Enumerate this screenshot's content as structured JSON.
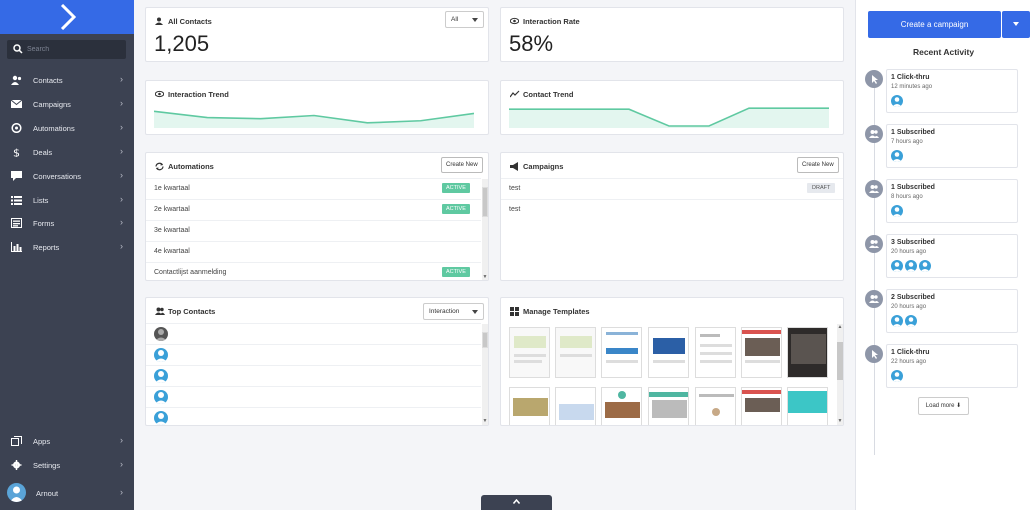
{
  "sidebar": {
    "search_placeholder": "Search",
    "items": [
      {
        "label": "Contacts",
        "icon": "contacts-icon"
      },
      {
        "label": "Campaigns",
        "icon": "envelope-icon"
      },
      {
        "label": "Automations",
        "icon": "automation-icon"
      },
      {
        "label": "Deals",
        "icon": "dollar-icon"
      },
      {
        "label": "Conversations",
        "icon": "chat-icon"
      },
      {
        "label": "Lists",
        "icon": "list-icon"
      },
      {
        "label": "Forms",
        "icon": "form-icon"
      },
      {
        "label": "Reports",
        "icon": "bar-chart-icon"
      }
    ],
    "bottom_items": [
      {
        "label": "Apps",
        "icon": "apps-icon"
      },
      {
        "label": "Settings",
        "icon": "gear-icon"
      }
    ],
    "user": {
      "label": "Arnout"
    },
    "chevron": "›"
  },
  "stats": {
    "contacts": {
      "title": "All Contacts",
      "value": "1,205",
      "filter": "All"
    },
    "interaction": {
      "title": "Interaction Rate",
      "value": "58%"
    }
  },
  "trends": {
    "interaction": {
      "title": "Interaction Trend",
      "points": [
        14,
        8,
        7,
        10,
        3,
        5,
        12
      ],
      "ylim": [
        0,
        20
      ]
    },
    "contact": {
      "title": "Contact Trend",
      "points": [
        16,
        16,
        16,
        16,
        0,
        0,
        17,
        17,
        17
      ],
      "ylim": [
        0,
        20
      ]
    }
  },
  "automations": {
    "title": "Automations",
    "create_label": "Create New",
    "rows": [
      {
        "name": "1e kwartaal",
        "status": "ACTIVE"
      },
      {
        "name": "2e kwartaal",
        "status": "ACTIVE"
      },
      {
        "name": "3e kwartaal",
        "status": ""
      },
      {
        "name": "4e kwartaal",
        "status": ""
      },
      {
        "name": "Contactlijst aanmelding",
        "status": "ACTIVE"
      }
    ]
  },
  "campaigns": {
    "title": "Campaigns",
    "create_label": "Create New",
    "rows": [
      {
        "name": "test",
        "status": "DRAFT"
      },
      {
        "name": "test",
        "status": ""
      }
    ]
  },
  "top_contacts": {
    "title": "Top Contacts",
    "filter": "Interaction"
  },
  "templates": {
    "title": "Manage Templates"
  },
  "right_panel": {
    "create_button": "Create a campaign",
    "recent_title": "Recent Activity",
    "load_more": "Load more",
    "load_more_arrow": "⬇",
    "activities": [
      {
        "title": "1 Click-thru",
        "time": "12 minutes ago",
        "avatars": 1,
        "icon": "click-icon"
      },
      {
        "title": "1 Subscribed",
        "time": "7 hours ago",
        "avatars": 1,
        "icon": "subscribe-icon"
      },
      {
        "title": "1 Subscribed",
        "time": "8 hours ago",
        "avatars": 1,
        "icon": "subscribe-icon"
      },
      {
        "title": "3 Subscribed",
        "time": "20 hours ago",
        "avatars": 3,
        "icon": "subscribe-icon"
      },
      {
        "title": "2 Subscribed",
        "time": "20 hours ago",
        "avatars": 2,
        "icon": "subscribe-icon"
      },
      {
        "title": "1 Click-thru",
        "time": "22 hours ago",
        "avatars": 1,
        "icon": "click-icon"
      }
    ]
  },
  "colors": {
    "sidebar": "#3c4252",
    "primary": "#356ae6",
    "trend_line": "#5fc9a1",
    "trend_fill": "#e3f6ef",
    "active_badge": "#5fc9a1"
  }
}
